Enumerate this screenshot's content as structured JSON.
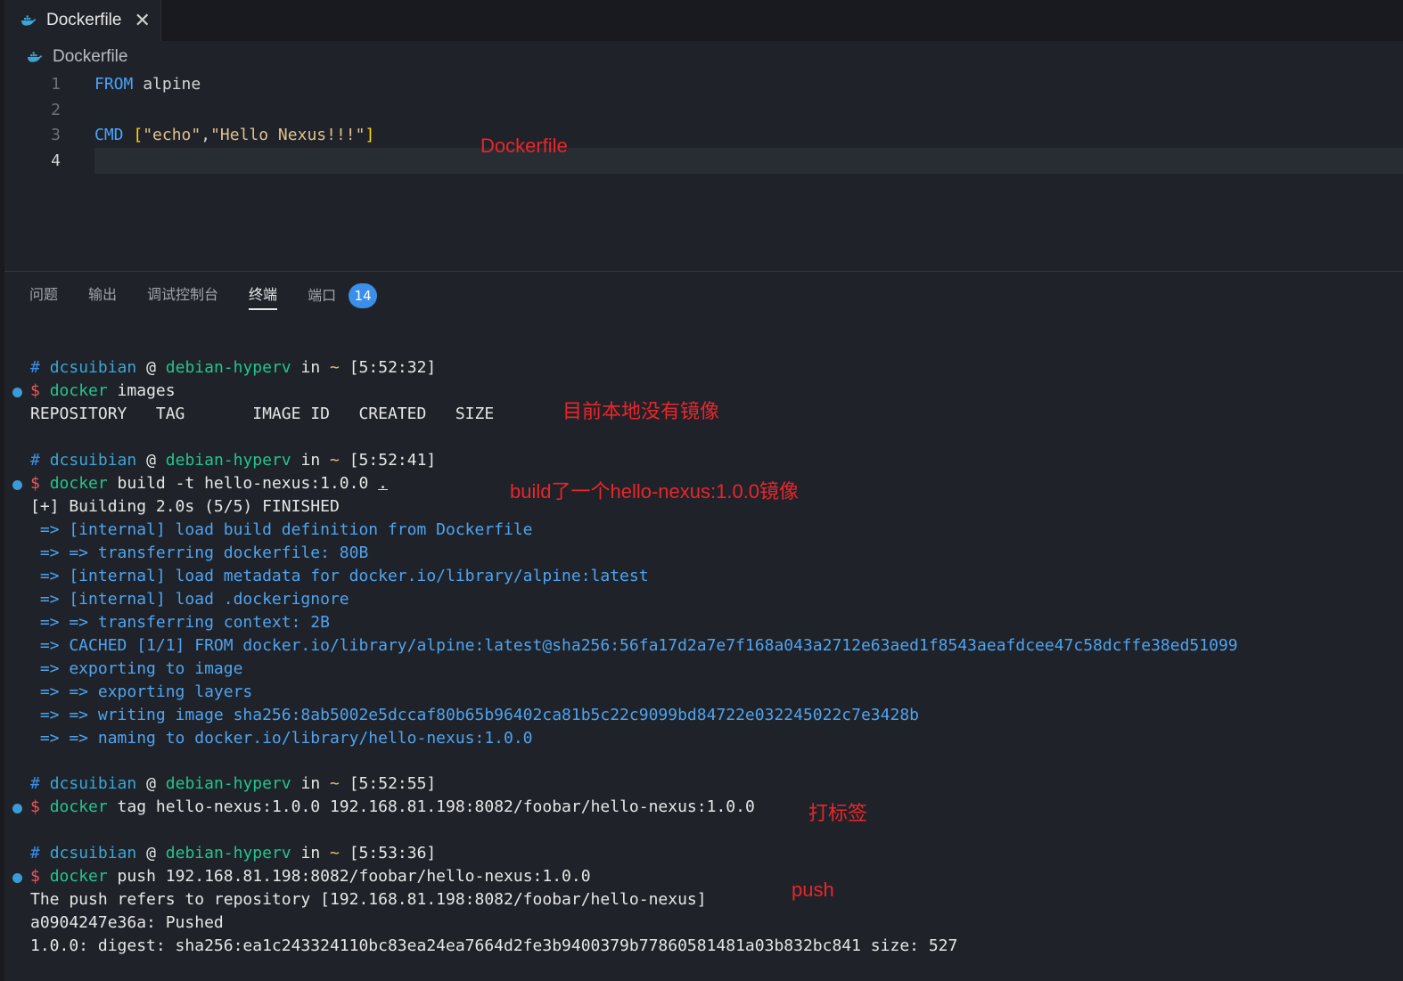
{
  "tab": {
    "title": "Dockerfile",
    "close": "✕"
  },
  "breadcrumb": {
    "file": "Dockerfile"
  },
  "editor": {
    "lines": [
      {
        "num": "1",
        "kw": "FROM",
        "rest": " alpine"
      },
      {
        "num": "2"
      },
      {
        "num": "3",
        "kw": "CMD",
        "open": " [",
        "s1": "\"echo\"",
        "comma": ",",
        "s2": "\"Hello Nexus!!!\"",
        "close": "]"
      },
      {
        "num": "4"
      }
    ]
  },
  "annotations": {
    "dockerfile": "Dockerfile",
    "no_images": "目前本地没有镜像",
    "build": "build了一个hello-nexus:1.0.0镜像",
    "tag": "打标签",
    "push": "push"
  },
  "panel": {
    "tabs": [
      "问题",
      "输出",
      "调试控制台",
      "终端",
      "端口"
    ],
    "active_tab": "终端",
    "ports_badge": "14"
  },
  "terminal": {
    "prompt": {
      "hash": "#",
      "user": "dcsuibian",
      "at": "@",
      "host": "debian-hyperv",
      "in": "in",
      "tilde": "~"
    },
    "blocks": [
      {
        "time": "[5:52:32]",
        "cmd": "docker",
        "args": " images",
        "output": [
          "REPOSITORY   TAG       IMAGE ID   CREATED   SIZE"
        ]
      },
      {
        "time": "[5:52:41]",
        "cmd": "docker",
        "args": " build -t hello-nexus:1.0.0 ",
        "args_end": ".",
        "output_white": "[+] Building 2.0s (5/5) FINISHED",
        "output_blue": [
          " => [internal] load build definition from Dockerfile",
          " => => transferring dockerfile: 80B",
          " => [internal] load metadata for docker.io/library/alpine:latest",
          " => [internal] load .dockerignore",
          " => => transferring context: 2B",
          " => CACHED [1/1] FROM docker.io/library/alpine:latest@sha256:56fa17d2a7e7f168a043a2712e63aed1f8543aeafdcee47c58dcffe38ed51099",
          " => exporting to image",
          " => => exporting layers",
          " => => writing image sha256:8ab5002e5dccaf80b65b96402ca81b5c22c9099bd84722e032245022c7e3428b",
          " => => naming to docker.io/library/hello-nexus:1.0.0"
        ]
      },
      {
        "time": "[5:52:55]",
        "cmd": "docker",
        "args": " tag hello-nexus:1.0.0 192.168.81.198:8082/foobar/hello-nexus:1.0.0"
      },
      {
        "time": "[5:53:36]",
        "cmd": "docker",
        "args": " push 192.168.81.198:8082/foobar/hello-nexus:1.0.0",
        "output": [
          "The push refers to repository [192.168.81.198:8082/foobar/hello-nexus]",
          "a0904247e36a: Pushed",
          "1.0.0: digest: sha256:ea1c243324110bc83ea24ea7664d2fe3b9400379b77860581481a03b832bc841 size: 527"
        ]
      }
    ]
  }
}
